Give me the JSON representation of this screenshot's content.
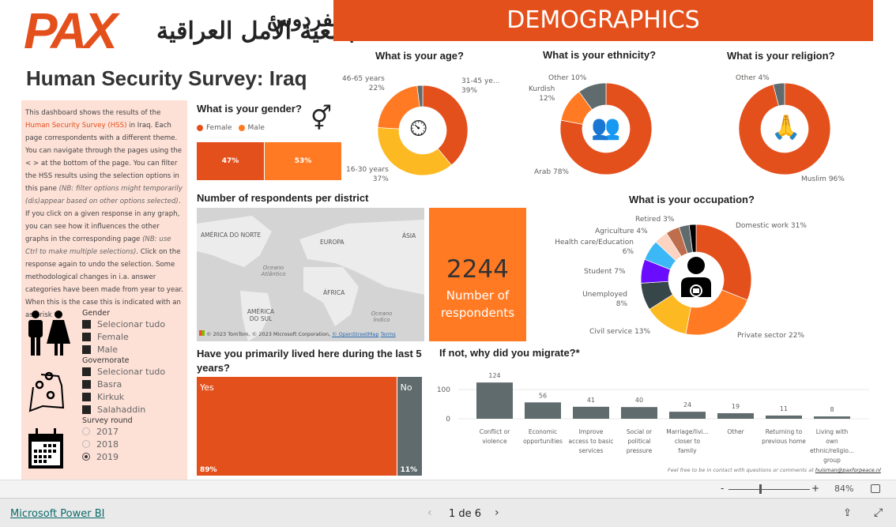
{
  "header": {
    "logo_text": "PAX",
    "logo_arabic_1": "جمعية الأمل العراقية",
    "logo_arabic_2": "الفردوس",
    "banner": "DEMOGRAPHICS",
    "title": "Human Security Survey: Iraq"
  },
  "sidebar": {
    "intro_1": "This dashboard shows the results of the ",
    "intro_link": "Human Security Survey (HSS)",
    "intro_2": " in Iraq. Each page correspondents with a different theme. You can navigate through the pages using the < > at the bottom of the page. You can filter the HSS results using the selection options in this pane ",
    "intro_note1": "(NB: filter options might temporarily (dis)appear based on other options selected)",
    "intro_3": ". If you click on a given response in any graph, you can see how it influences the other graphs in the corresponding page ",
    "intro_note2": "(NB: use Ctrl to make multiple selections)",
    "intro_4": ". Click on the response again to undo the selection. Some methodological changes in i.a. answer categories have been made from year to year. When this is the case this is indicated with an asterisk *.",
    "gender": {
      "title": "Gender",
      "items": [
        "Selecionar tudo",
        "Female",
        "Male"
      ]
    },
    "governorate": {
      "title": "Governorate",
      "items": [
        "Selecionar tudo",
        "Basra",
        "Kirkuk",
        "Salahaddin"
      ]
    },
    "survey_round": {
      "title": "Survey round",
      "items": [
        "2017",
        "2018",
        "2019"
      ],
      "selected": "2019"
    }
  },
  "colors": {
    "red": "#E4501C",
    "orange": "#FF7A22",
    "yellow": "#FDB921",
    "gray": "#5F6B6D",
    "slate": "#374649",
    "purple": "#6A0DFF",
    "blue": "#3BB8F5",
    "peach": "#FDD3C1",
    "brown": "#BE6E4C",
    "black": "#000000"
  },
  "gender_chart": {
    "title": "What is your gender?",
    "legend": [
      "Female",
      "Male"
    ],
    "values": [
      47,
      53
    ],
    "labels": [
      "47%",
      "53%"
    ]
  },
  "age_chart": {
    "title": "What is your age?",
    "slices": [
      {
        "label": "31-45 ye...",
        "pct": "39%",
        "value": 39,
        "color": "#E4501C"
      },
      {
        "label": "16-30 years",
        "pct": "37%",
        "value": 37,
        "color": "#FDB921"
      },
      {
        "label": "46-65 years",
        "pct": "22%",
        "value": 22,
        "color": "#FF7A22"
      },
      {
        "label": "",
        "pct": "",
        "value": 2,
        "color": "#5F6B6D"
      }
    ]
  },
  "ethnicity_chart": {
    "title": "What is your ethnicity?",
    "slices": [
      {
        "label": "Arab",
        "pct": "78%",
        "value": 78,
        "color": "#E4501C"
      },
      {
        "label": "Kurdish",
        "pct": "12%",
        "value": 12,
        "color": "#FF7A22"
      },
      {
        "label": "Other",
        "pct": "10%",
        "value": 10,
        "color": "#5F6B6D"
      }
    ]
  },
  "religion_chart": {
    "title": "What is your religion?",
    "slices": [
      {
        "label": "Muslim",
        "pct": "96%",
        "value": 96,
        "color": "#E4501C"
      },
      {
        "label": "Other",
        "pct": "4%",
        "value": 4,
        "color": "#5F6B6D"
      }
    ]
  },
  "district": {
    "title": "Number of respondents per district",
    "map_labels": [
      "AMÉRICA DO NORTE",
      "EUROPA",
      "ÁSIA",
      "Oceano Atlântico",
      "ÁFRICA",
      "AMÉRICA DO SUL",
      "Oceano Índico"
    ],
    "attribution": "© 2023 TomTom, © 2023 Microsoft Corporation, ",
    "osm": "© OpenStreetMap",
    "terms": "Terms"
  },
  "respondents": {
    "value": "2244",
    "label": "Number of respondents"
  },
  "occupation_chart": {
    "title": "What is your occupation?",
    "slices": [
      {
        "label": "Domestic work 31%",
        "value": 31,
        "color": "#E4501C"
      },
      {
        "label": "Private sector 22%",
        "value": 22,
        "color": "#FF7A22"
      },
      {
        "label": "Civil service 13%",
        "value": 13,
        "color": "#FDB921"
      },
      {
        "label": "Unemployed 8%",
        "value": 8,
        "color": "#374649"
      },
      {
        "label": "Student 7%",
        "value": 7,
        "color": "#6A0DFF"
      },
      {
        "label": "Health care/Education 6%",
        "value": 6,
        "color": "#3BB8F5"
      },
      {
        "label": "",
        "value": 4,
        "color": "#FDD3C1"
      },
      {
        "label": "Agriculture 4%",
        "value": 4,
        "color": "#BE6E4C"
      },
      {
        "label": "Retired 3%",
        "value": 3,
        "color": "#5F6B6D"
      },
      {
        "label": "",
        "value": 2,
        "color": "#000000"
      }
    ]
  },
  "lived_chart": {
    "title": "Have you primarily lived here during the last 5 years?",
    "categories": [
      "Yes",
      "No"
    ],
    "values": [
      89,
      11
    ],
    "pcts": [
      "89%",
      "11%"
    ]
  },
  "chart_data": {
    "type": "bar",
    "title": "If not, why did you migrate?*",
    "categories": [
      "Conflict or violence",
      "Economic opportunities",
      "Improve access to basic services",
      "Social or political pressure",
      "Marriage/livi... closer to family",
      "Other",
      "Returning to previous home",
      "Living with own ethnic/religio... group"
    ],
    "values": [
      124,
      56,
      41,
      40,
      24,
      19,
      11,
      8
    ],
    "yticks": [
      0,
      100
    ],
    "ylim": [
      0,
      135
    ]
  },
  "feedback": {
    "text": "Feel free to be in contact with questions or comments at ",
    "email": "huisman@paxforpeace.nl"
  },
  "zoom": {
    "minus": "-",
    "plus": "+",
    "level": "84%"
  },
  "footer": {
    "brand": "Microsoft Power BI",
    "page": "1 de 6"
  }
}
